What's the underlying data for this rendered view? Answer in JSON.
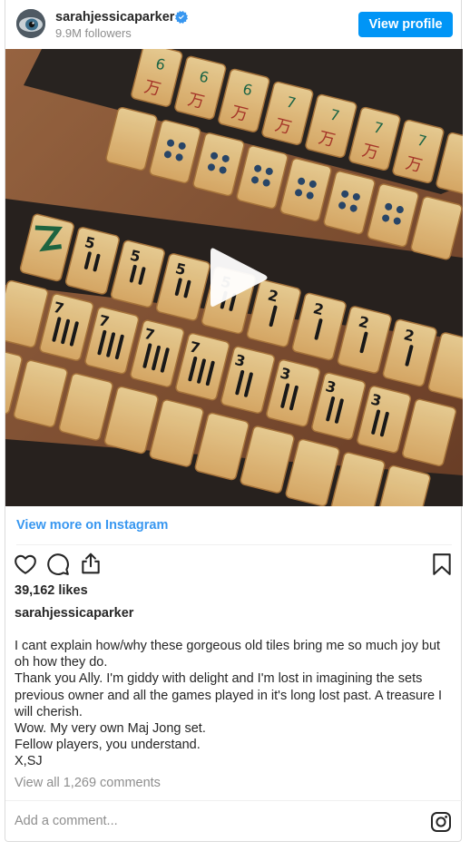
{
  "header": {
    "username": "sarahjessicaparker",
    "followers": "9.9M followers",
    "view_profile_label": "View profile"
  },
  "media": {
    "type": "video",
    "description_icon": "play-icon"
  },
  "view_more_label": "View more on Instagram",
  "actions": {
    "like_icon": "heart-icon",
    "comment_icon": "comment-icon",
    "share_icon": "share-icon",
    "save_icon": "bookmark-icon"
  },
  "likes": "39,162 likes",
  "caption": {
    "username": "sarahjessicaparker",
    "lines": [
      "I cant explain how/why these gorgeous old tiles bring me so much joy but",
      "oh how they do.",
      "Thank you Ally. I'm giddy with delight and I'm lost in imagining the sets",
      "previous owner and all the games played in it's long lost past. A treasure I",
      "will cherish.",
      "Wow. My very own Maj Jong set.",
      "Fellow players, you understand.",
      "X,SJ"
    ]
  },
  "view_comments": "View all 1,269 comments",
  "comment_placeholder": "Add a comment...",
  "colors": {
    "accent": "#0095f6",
    "link": "#3897f0",
    "muted": "#8e8e8e",
    "text": "#262626"
  }
}
